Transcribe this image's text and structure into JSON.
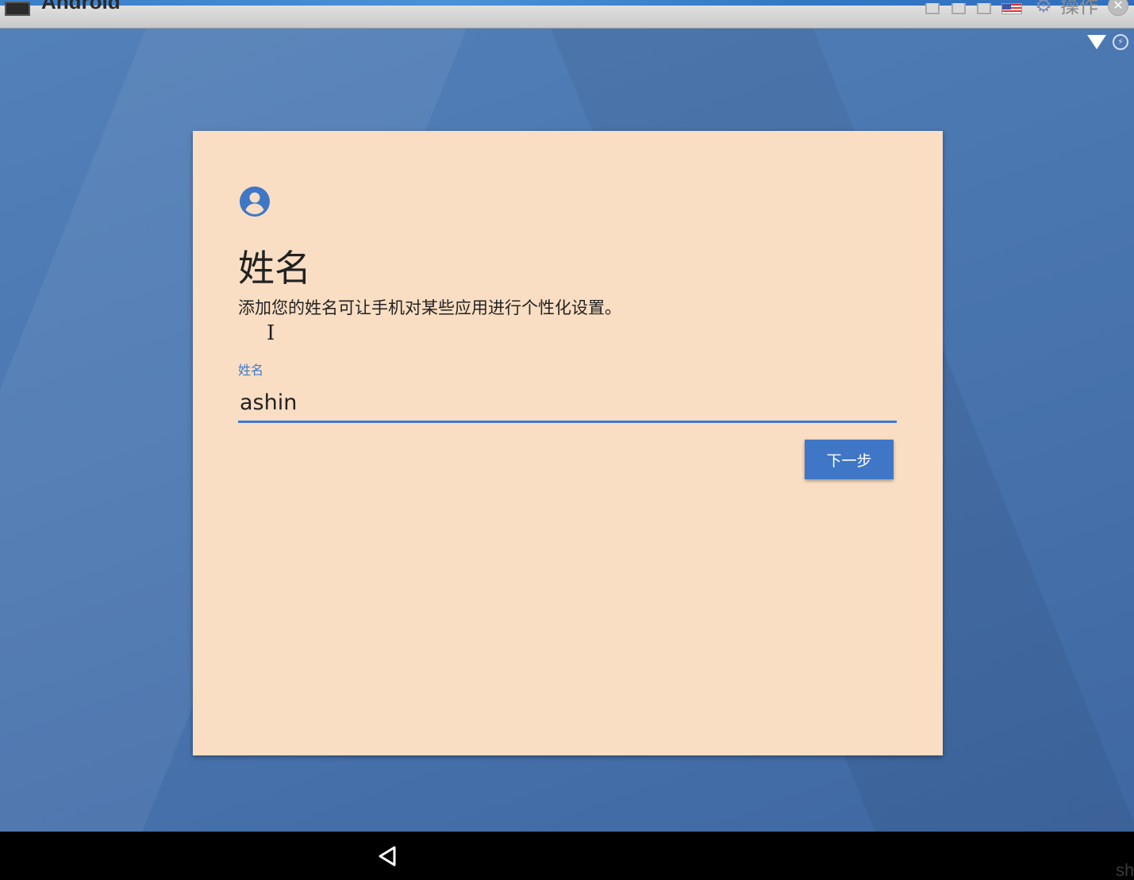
{
  "window": {
    "title": "Android",
    "menu_label": "操作",
    "close_glyph": "✕",
    "gear_glyph": "⚙"
  },
  "status": {
    "battery_glyph": "⚡"
  },
  "setup": {
    "title": "姓名",
    "description": "添加您的姓名可让手机对某些应用进行个性化设置。",
    "field_label": "姓名",
    "name_value": "ashin",
    "next_label": "下一步"
  },
  "cursor_glyph": "I",
  "corner_text": "sh",
  "colors": {
    "card": "#f9dec3",
    "accent": "#3f77c6",
    "background": "#4a76b0"
  }
}
